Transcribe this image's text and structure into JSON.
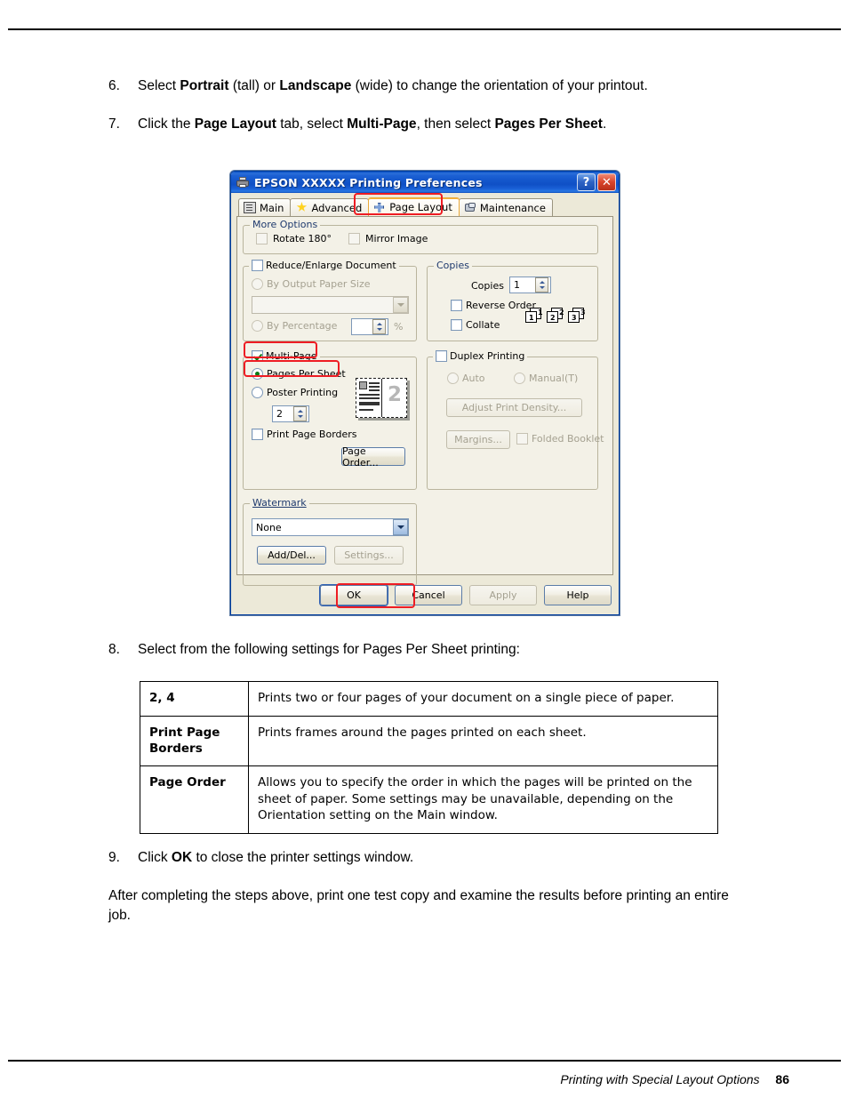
{
  "document": {
    "steps": [
      {
        "num": "6.",
        "html_parts": [
          "Select ",
          "Portrait",
          " (tall) or ",
          "Landscape",
          " (wide) to change the orientation of your printout."
        ]
      },
      {
        "num": "7.",
        "html_parts": [
          "Click the ",
          "Page Layout",
          " tab, select ",
          "Multi-Page",
          ", then select ",
          "Pages Per Sheet",
          "."
        ]
      }
    ],
    "step6_num": "6.",
    "step6_t1": "Select ",
    "step6_b1": "Portrait",
    "step6_t2": " (tall) or ",
    "step6_b2": "Landscape",
    "step6_t3": " (wide) to change the orientation of your printout.",
    "step7_num": "7.",
    "step7_t1": "Click the ",
    "step7_b1": "Page Layout",
    "step7_t2": " tab, select ",
    "step7_b2": "Multi-Page",
    "step7_t3": ", then select ",
    "step7_b3": "Pages Per Sheet",
    "step7_t4": ".",
    "step8_num": "8.",
    "step8_text": "Select from the following settings for Pages Per Sheet printing:",
    "step9_num": "9.",
    "step9_t1": "Click ",
    "step9_b1": "OK",
    "step9_t2": " to close the printer settings window.",
    "closing": "After completing the steps above, print one test copy and examine the results before printing an entire job.",
    "footer_title": "Printing with Special Layout Options",
    "page_number": "86"
  },
  "settings_table": {
    "rows": [
      {
        "key": "2, 4",
        "value": "Prints two or four pages of your document on a single piece of paper."
      },
      {
        "key": "Print Page Borders",
        "value": "Prints frames around the pages printed on each sheet."
      },
      {
        "key": "Page Order",
        "value": "Allows you to specify the order in which the pages will be printed on the sheet of paper. Some settings may be unavailable, depending on the Orientation setting on the Main window."
      }
    ]
  },
  "dialog": {
    "title": "EPSON  XXXXX  Printing Preferences",
    "window_icon": "printer-icon",
    "titlebar_buttons": {
      "help": "?",
      "close": "✕"
    },
    "tabs": [
      {
        "label": "Main",
        "icon": "page-icon",
        "active": false
      },
      {
        "label": "Advanced",
        "icon": "star-icon",
        "active": false
      },
      {
        "label": "Page Layout",
        "icon": "move-cross-icon",
        "active": true
      },
      {
        "label": "Maintenance",
        "icon": "wrench-icon",
        "active": false
      }
    ],
    "more_options": {
      "legend": "More Options",
      "rotate_180": {
        "label": "Rotate 180°",
        "checked": false
      },
      "mirror_image": {
        "label": "Mirror Image",
        "checked": false
      }
    },
    "reduce_enlarge": {
      "legend_checkbox": {
        "label": "Reduce/Enlarge Document",
        "checked": false
      },
      "by_output_paper_size": {
        "label": "By Output Paper Size",
        "selected": false
      },
      "paper_size_value": "",
      "by_percentage": {
        "label": "By Percentage",
        "selected": false
      },
      "percentage_value": "",
      "percent_sign": "%"
    },
    "copies": {
      "legend": "Copies",
      "copies_label": "Copies",
      "copies_value": "1",
      "reverse_order": {
        "label": "Reverse Order",
        "checked": false
      },
      "collate": {
        "label": "Collate",
        "checked": false
      },
      "collate_icons": [
        {
          "inner": "1",
          "outer": "1"
        },
        {
          "inner": "2",
          "outer": "2"
        },
        {
          "inner": "3",
          "outer": "3"
        }
      ]
    },
    "multi_page": {
      "legend_checkbox": {
        "label": "Multi-Page",
        "checked": true
      },
      "pages_per_sheet": {
        "label": "Pages Per Sheet",
        "selected": true
      },
      "poster_printing": {
        "label": "Poster Printing",
        "selected": false
      },
      "pages_count_value": "2",
      "print_page_borders": {
        "label": "Print Page Borders",
        "checked": false
      },
      "page_order_button": "Page Order...",
      "preview_number": "2"
    },
    "duplex": {
      "legend_checkbox": {
        "label": "Duplex Printing",
        "checked": false
      },
      "auto": {
        "label": "Auto",
        "selected": false
      },
      "manual": {
        "label": "Manual(T)",
        "selected": false
      },
      "adjust_print_density_button": "Adjust Print Density...",
      "margins_button": "Margins...",
      "folded_booklet": {
        "label": "Folded Booklet",
        "checked": false
      }
    },
    "watermark": {
      "legend": "Watermark",
      "selected_value": "None",
      "add_del_button": "Add/Del...",
      "settings_button": "Settings..."
    },
    "footer_buttons": {
      "ok": "OK",
      "cancel": "Cancel",
      "apply": "Apply",
      "help": "Help"
    }
  },
  "annotations": {
    "highlight_color": "#ee1c23",
    "highlights": [
      "page-layout-tab",
      "multi-page-checkbox",
      "pages-per-sheet-radio",
      "ok-button"
    ]
  }
}
